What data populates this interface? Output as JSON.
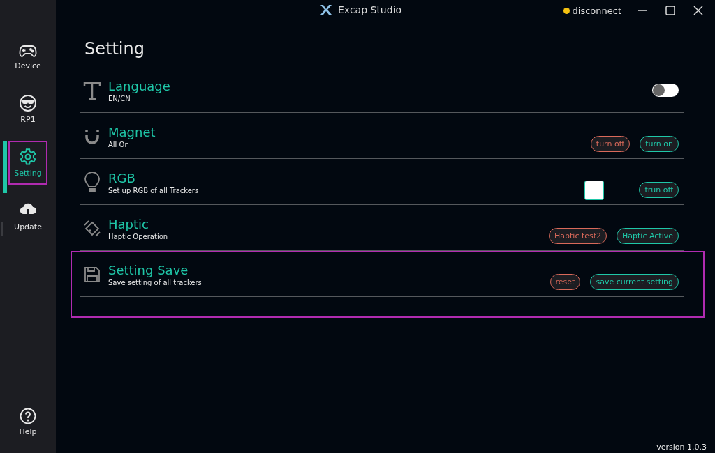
{
  "window": {
    "title": "Excap Studio",
    "status": {
      "label": "disconnect",
      "color": "#f5c211"
    }
  },
  "sidebar": {
    "items": [
      {
        "label": "Device",
        "selected": false,
        "highlighted": false
      },
      {
        "label": "RP1",
        "selected": false,
        "highlighted": false
      },
      {
        "label": "Setting",
        "selected": true,
        "highlighted": true
      },
      {
        "label": "Update",
        "selected": false,
        "highlighted": false
      }
    ],
    "help": {
      "label": "Help"
    }
  },
  "page_title": "Setting",
  "rows": [
    {
      "title": "Language",
      "subtitle": "EN/CN",
      "highlighted": false,
      "controls": [
        {
          "kind": "toggle",
          "on": false
        }
      ]
    },
    {
      "title": "Magnet",
      "subtitle": "All On",
      "highlighted": false,
      "controls": [
        {
          "kind": "button",
          "label": "turn off",
          "color": "#d9695a"
        },
        {
          "kind": "button",
          "label": "turn on",
          "color": "#1fc7a8"
        }
      ]
    },
    {
      "title": "RGB",
      "subtitle": "Set up RGB of all Trackers",
      "highlighted": false,
      "controls": [
        {
          "kind": "swatch",
          "color": "#ffffff"
        },
        {
          "kind": "button",
          "label": "trun off",
          "color": "#1fc7a8"
        }
      ]
    },
    {
      "title": "Haptic",
      "subtitle": "Haptic Operation",
      "highlighted": false,
      "controls": [
        {
          "kind": "button",
          "label": "Haptic test2",
          "color": "#d9695a"
        },
        {
          "kind": "button",
          "label": "Haptic Active",
          "color": "#1fc7a8"
        }
      ]
    },
    {
      "title": "Setting Save",
      "subtitle": "Save setting of all trackers",
      "highlighted": true,
      "controls": [
        {
          "kind": "button",
          "label": "reset",
          "color": "#d9695a"
        },
        {
          "kind": "button",
          "label": "save current setting",
          "color": "#1fc7a8"
        }
      ]
    }
  ],
  "version": "version 1.0.3"
}
